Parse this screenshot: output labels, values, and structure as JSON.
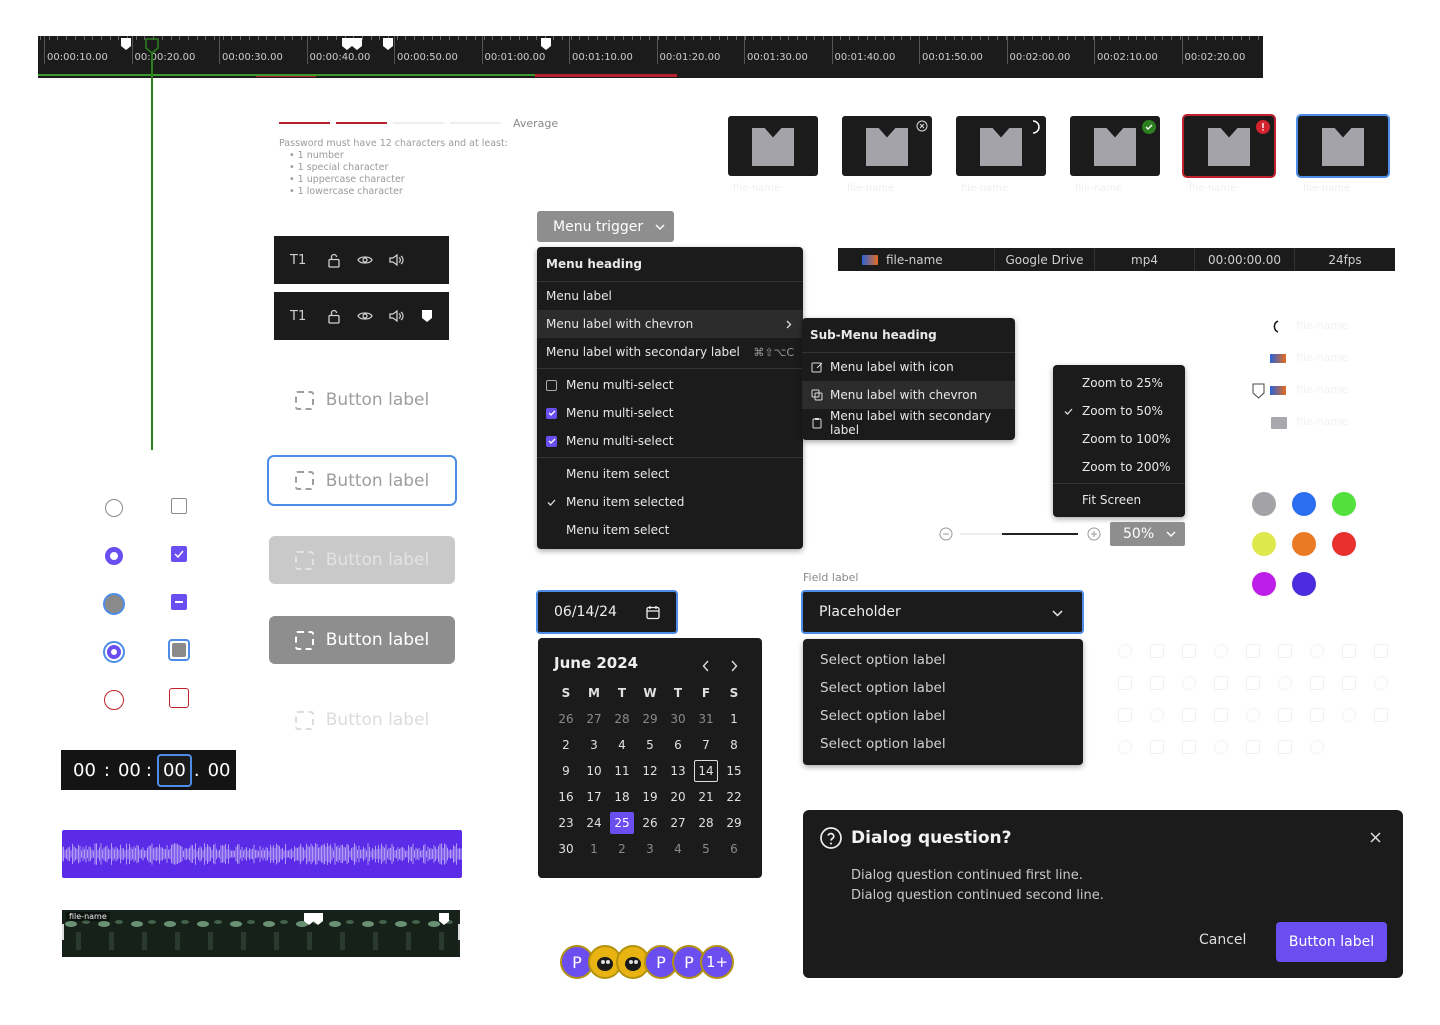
{
  "timeline": {
    "labels": [
      "00:00:10.00",
      "00:00:20.00",
      "00:00:30.00",
      "00:00:40.00",
      "00:00:50.00",
      "00:01:00.00",
      "00:01:10.00",
      "00:01:20.00",
      "00:01:30.00",
      "00:01:40.00",
      "00:01:50.00",
      "00:02:00.00",
      "00:02:10.00",
      "00:02:20.00"
    ]
  },
  "password": {
    "strength_label": "Average",
    "hint_title": "Password must have 12 characters and at least:",
    "rules": [
      "1 number",
      "1 special character",
      "1 uppercase character",
      "1 lowercase character"
    ]
  },
  "tracks": [
    {
      "label": "T1"
    },
    {
      "label": "T1"
    }
  ],
  "buttons": {
    "label": "Button label"
  },
  "time_input": {
    "h": "00",
    "m": "00",
    "s": "00",
    "f": "00"
  },
  "waveform": {
    "color": "#5b2be8"
  },
  "filmstrip": {
    "name": "file-name"
  },
  "menu_trigger": {
    "label": "Menu trigger"
  },
  "menu": {
    "heading": "Menu heading",
    "label": "Menu label",
    "label_chevron": "Menu label with chevron",
    "label_secondary": "Menu label with secondary label",
    "shortcut": "⌘⇧⌥C",
    "multi": [
      {
        "label": "Menu multi-select",
        "checked": false
      },
      {
        "label": "Menu multi-select",
        "checked": true
      },
      {
        "label": "Menu multi-select",
        "checked": true
      }
    ],
    "select": [
      {
        "label": "Menu item select",
        "selected": false
      },
      {
        "label": "Menu item selected",
        "selected": true
      },
      {
        "label": "Menu item select",
        "selected": false
      }
    ]
  },
  "submenu": {
    "heading": "Sub-Menu heading",
    "items": [
      "Menu label with icon",
      "Menu label with chevron",
      "Menu label with secondary label"
    ]
  },
  "zoom_menu": {
    "items": [
      "Zoom to 25%",
      "Zoom to 50%",
      "Zoom to 100%",
      "Zoom to 200%"
    ],
    "fit": "Fit Screen",
    "selected_index": 1
  },
  "zoom_control": {
    "value": "50%"
  },
  "file_row": {
    "name": "file-name",
    "source": "Google Drive",
    "format": "mp4",
    "duration": "00:00:00.00",
    "fps": "24fps"
  },
  "thumbnails": {
    "caption": "file-name",
    "states": [
      "default",
      "remove",
      "loading",
      "done",
      "error",
      "selected"
    ]
  },
  "file_list": {
    "name": "file-name"
  },
  "date_input": {
    "value": "06/14/24"
  },
  "calendar": {
    "title": "June 2024",
    "weekdays": [
      "S",
      "M",
      "T",
      "W",
      "T",
      "F",
      "S"
    ],
    "weeks": [
      [
        "26",
        "27",
        "28",
        "29",
        "30",
        "31",
        "1"
      ],
      [
        "2",
        "3",
        "4",
        "5",
        "6",
        "7",
        "8"
      ],
      [
        "9",
        "10",
        "11",
        "12",
        "13",
        "14",
        "15"
      ],
      [
        "16",
        "17",
        "18",
        "19",
        "20",
        "21",
        "22"
      ],
      [
        "23",
        "24",
        "25",
        "26",
        "27",
        "28",
        "29"
      ],
      [
        "30",
        "1",
        "2",
        "3",
        "4",
        "5",
        "6"
      ]
    ],
    "today": "14",
    "selected": "25"
  },
  "select": {
    "field_label": "Field label",
    "placeholder": "Placeholder",
    "options": [
      "Select option label",
      "Select option label",
      "Select option label",
      "Select option label"
    ]
  },
  "dialog": {
    "title": "Dialog question?",
    "line1": "Dialog question continued first line.",
    "line2": "Dialog question continued second line.",
    "cancel": "Cancel",
    "confirm": "Button label"
  },
  "swatches": [
    "#a3a2a7",
    "#2b6ff0",
    "#53df3c",
    "#dce84c",
    "#ec7a24",
    "#e8312f",
    "#be1ee8",
    "#4d2ce0"
  ],
  "avatars": {
    "initial": "P",
    "more": "1+"
  },
  "colors": {
    "accent": "#6b4ef0",
    "focus": "#4d8de8",
    "error": "#c0222d",
    "green": "#2d7e20"
  }
}
